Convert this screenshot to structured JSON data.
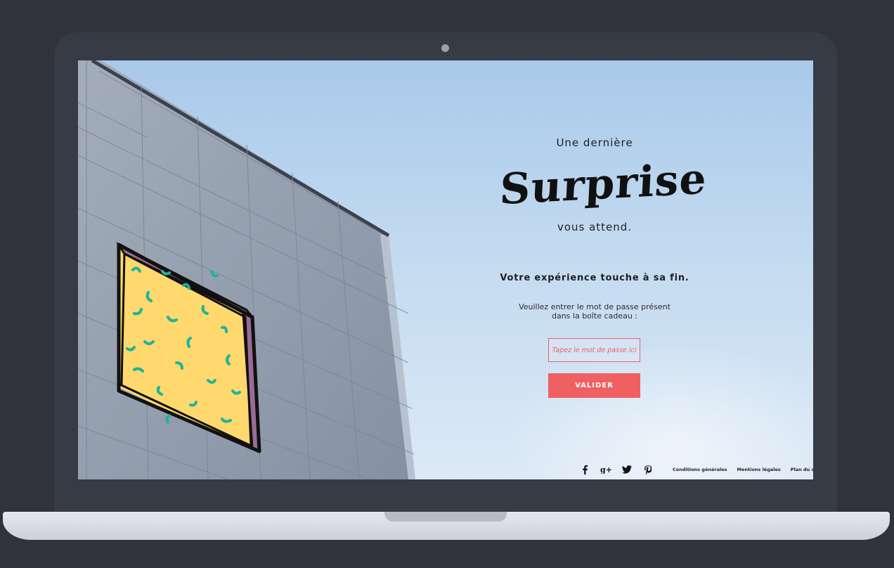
{
  "hero": {
    "line1": "Une dernière",
    "script_word": "Surprise",
    "line2": "vous attend."
  },
  "main": {
    "end_text": "Votre expérience touche à sa fin.",
    "instruction_line1": "Veuillez entrer le mot de passe présent",
    "instruction_line2": "dans la boîte cadeau :",
    "password_placeholder": "Tapez le mot de passe ici",
    "submit_label": "VALIDER"
  },
  "footer": {
    "social": [
      "facebook-icon",
      "google-plus-icon",
      "twitter-icon",
      "pinterest-icon"
    ],
    "links": [
      "Conditions générales",
      "Mentions légales",
      "Plan du site"
    ]
  },
  "colors": {
    "accent": "#ef6062",
    "window_yellow": "#ffd86e",
    "squiggle_teal": "#1fb39a",
    "frame_purple": "#9a6b95",
    "laptop_dark": "#373b46"
  }
}
